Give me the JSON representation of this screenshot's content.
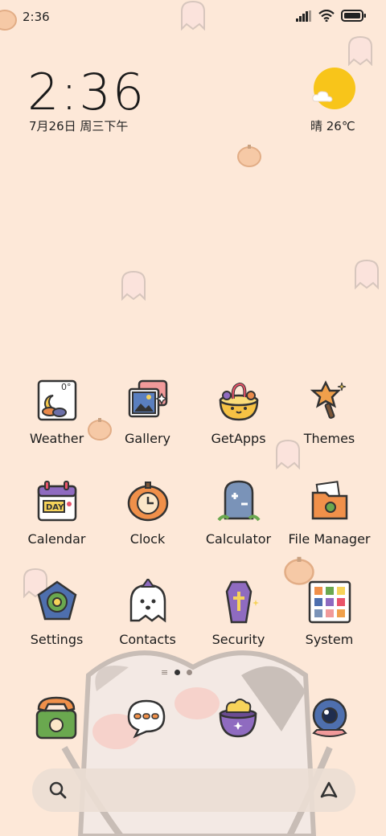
{
  "status_bar": {
    "time": "2:36"
  },
  "clock_widget": {
    "time": "2:36",
    "date": "7月26日 周三下午"
  },
  "weather_widget": {
    "text": "晴 26℃"
  },
  "apps": [
    {
      "label": "Weather",
      "icon": "weather-icon"
    },
    {
      "label": "Gallery",
      "icon": "gallery-icon"
    },
    {
      "label": "GetApps",
      "icon": "getapps-icon"
    },
    {
      "label": "Themes",
      "icon": "themes-icon"
    },
    {
      "label": "Calendar",
      "icon": "calendar-icon"
    },
    {
      "label": "Clock",
      "icon": "clock-icon"
    },
    {
      "label": "Calculator",
      "icon": "calculator-icon"
    },
    {
      "label": "File Manager",
      "icon": "file-manager-icon"
    },
    {
      "label": "Settings",
      "icon": "settings-icon"
    },
    {
      "label": "Contacts",
      "icon": "contacts-icon"
    },
    {
      "label": "Security",
      "icon": "security-icon"
    },
    {
      "label": "System",
      "icon": "system-icon"
    }
  ],
  "dock": [
    "phone-icon",
    "messages-icon",
    "cauldron-icon",
    "camera-icon"
  ],
  "colors": {
    "background": "#fde8d8",
    "sun": "#f8c51a"
  }
}
